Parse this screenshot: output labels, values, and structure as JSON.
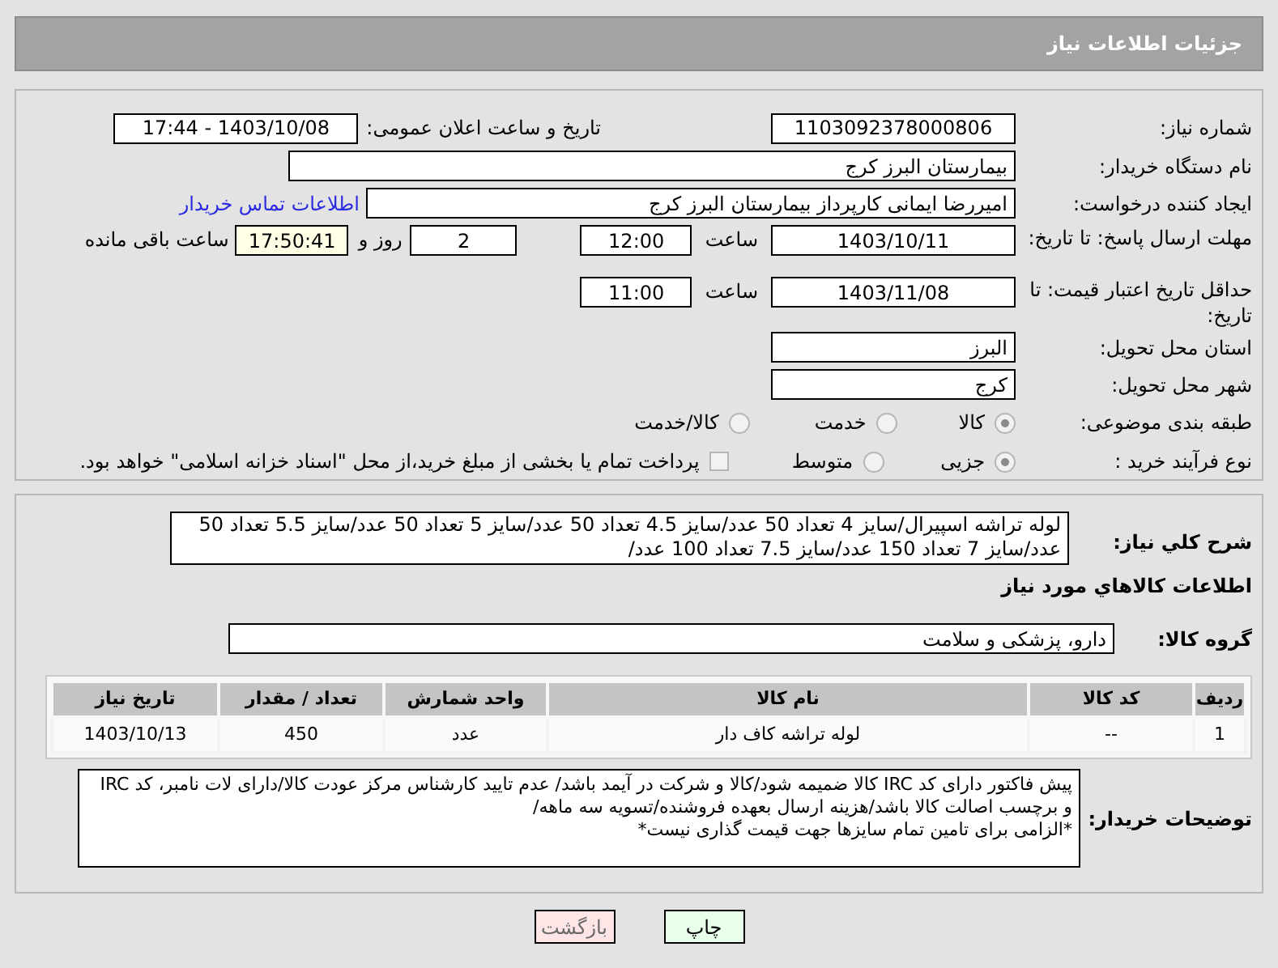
{
  "header": {
    "title": "جزئیات اطلاعات نیاز"
  },
  "need_number": {
    "label": "شماره نیاز:",
    "value": "1103092378000806"
  },
  "announce": {
    "label": "تاریخ و ساعت اعلان عمومی:",
    "value": "1403/10/08 - 17:44"
  },
  "buyer": {
    "label": "نام دستگاه خریدار:",
    "value": "بیمارستان البرز کرج"
  },
  "creator": {
    "label": "ایجاد کننده درخواست:",
    "value": "امیررضا ایمانی کارپرداز بیمارستان البرز کرج",
    "link": "اطلاعات تماس خریدار"
  },
  "reply_deadline": {
    "label": "مهلت ارسال پاسخ: تا تاریخ:",
    "date": "1403/10/11",
    "time_label": "ساعت",
    "time": "12:00",
    "days": "2",
    "days_label": "روز و",
    "remaining": "17:50:41",
    "remaining_label": "ساعت باقی مانده"
  },
  "price_validity": {
    "label": "حداقل تاریخ اعتبار قیمت: تا تاریخ:",
    "date": "1403/11/08",
    "time_label": "ساعت",
    "time": "11:00"
  },
  "province": {
    "label": "استان محل تحویل:",
    "value": "البرز"
  },
  "city": {
    "label": "شهر محل تحویل:",
    "value": "کرج"
  },
  "category": {
    "label": "طبقه بندی موضوعی:",
    "options": [
      {
        "label": "کالا",
        "selected": true
      },
      {
        "label": "خدمت",
        "selected": false
      },
      {
        "label": "کالا/خدمت",
        "selected": false
      }
    ]
  },
  "purchase_type": {
    "label": "نوع فرآیند خرید :",
    "options": [
      {
        "label": "جزیی",
        "selected": true
      },
      {
        "label": "متوسط",
        "selected": false
      }
    ],
    "payment": {
      "label": "پرداخت تمام یا بخشی از مبلغ خرید،از محل \"اسناد خزانه اسلامی\" خواهد بود.",
      "checked": false
    }
  },
  "description": {
    "label": "شرح کلي نیاز:",
    "value": "لوله تراشه اسپیرال/سایز 4 تعداد 50 عدد/سایز 4.5 تعداد 50 عدد/سایز 5 تعداد 50 عدد/سایز 5.5 تعداد 50 عدد/سایز 7 تعداد 150 عدد/سایز 7.5 تعداد 100 عدد/"
  },
  "goods_title": "اطلاعات کالاهاي مورد نیاز",
  "goods_group": {
    "label": "گروه کالا:",
    "value": "دارو، پزشکی و سلامت"
  },
  "table": {
    "columns": [
      "ردیف",
      "کد کالا",
      "نام کالا",
      "واحد شمارش",
      "تعداد / مقدار",
      "تاریخ نیاز"
    ],
    "rows": [
      [
        "1",
        "--",
        "لوله تراشه کاف دار",
        "عدد",
        "450",
        "1403/10/13"
      ]
    ]
  },
  "buyer_notes": {
    "label": "توضیحات خریدار:",
    "lines": [
      "پیش فاکتور دارای کد IRC کالا ضمیمه شود/کالا و شرکت در آیمد باشد/ عدم تایید کارشناس مرکز عودت کالا/دارای لات نامبر، کد IRC و برچسب اصالت کالا باشد/هزینه ارسال بعهده فروشنده/تسویه سه ماهه/",
      "*الزامی برای تامین تمام سایزها جهت قیمت گذاری نیست*"
    ]
  },
  "buttons": [
    {
      "label": "چاپ",
      "kind": "print"
    },
    {
      "label": "بازگشت",
      "kind": "back"
    }
  ]
}
